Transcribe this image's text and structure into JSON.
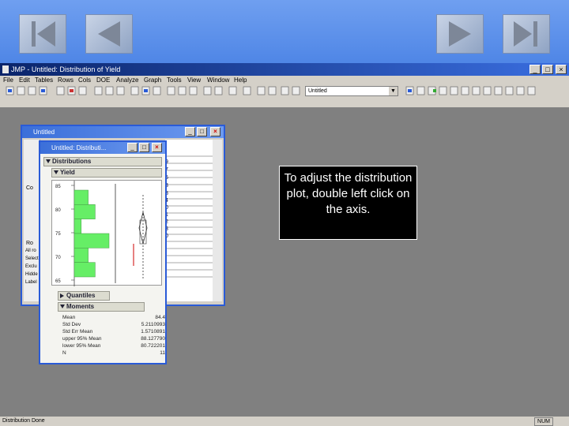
{
  "nav": {
    "first_icon": "first-slide-icon",
    "prev_icon": "previous-slide-icon",
    "next_icon": "next-slide-icon",
    "last_icon": "last-slide-icon"
  },
  "app": {
    "title": "JMP - Untitled: Distribution of Yield",
    "menus": [
      "File",
      "Edit",
      "Tables",
      "Rows",
      "Cols",
      "DOE",
      "Analyze",
      "Graph",
      "Tools",
      "View",
      "Window",
      "Help"
    ],
    "combo_value": "Untitled",
    "status_left": "Distribution Done",
    "status_right": "NUM"
  },
  "back_window": {
    "title": "Untitled",
    "left_labels": [
      "Co",
      "Ro",
      "All ro",
      "Select",
      "Exclu",
      "Hidde",
      "Label"
    ],
    "row_numbers": [
      "9",
      "7",
      "6",
      "3",
      "8",
      "4",
      "0",
      "1",
      "2",
      "3",
      "0"
    ]
  },
  "dist_window": {
    "title": "Untitled: Distributi...",
    "section_distributions": "Distributions",
    "section_yield": "Yield",
    "axis_ticks": [
      "85",
      "80",
      "75",
      "70",
      "65"
    ],
    "section_quantiles": "Quantiles",
    "section_moments": "Moments",
    "moments": [
      {
        "label": "Mean",
        "value": "84.4"
      },
      {
        "label": "Std Dev",
        "value": "5.2110993"
      },
      {
        "label": "Std Err Mean",
        "value": "1.5710891"
      },
      {
        "label": "upper 95% Mean",
        "value": "88.127790"
      },
      {
        "label": "lower 95% Mean",
        "value": "80.722201"
      },
      {
        "label": "N",
        "value": "11"
      }
    ]
  },
  "histogram": {
    "bar_fill": "#66ee66",
    "bins": [
      2,
      3,
      1,
      5,
      2,
      3
    ]
  },
  "callout": {
    "text": "To adjust the distribution plot, double left click on the axis."
  }
}
